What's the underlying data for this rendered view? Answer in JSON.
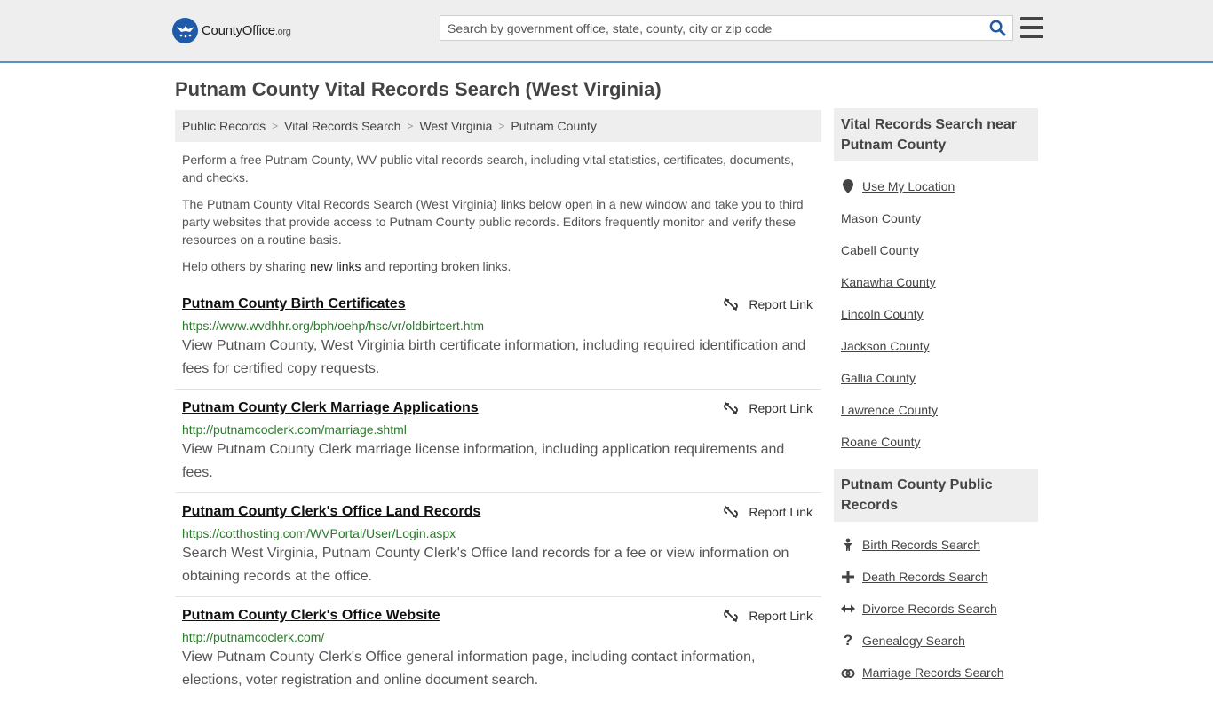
{
  "header": {
    "logo_text_main": "County",
    "logo_text_bold": "Office",
    "logo_text_org": ".org",
    "search_placeholder": "Search by government office, state, county, city or zip code"
  },
  "page_title": "Putnam County Vital Records Search (West Virginia)",
  "breadcrumb": [
    "Public Records",
    "Vital Records Search",
    "West Virginia",
    "Putnam County"
  ],
  "intro": {
    "p1": "Perform a free Putnam County, WV public vital records search, including vital statistics, certificates, documents, and checks.",
    "p2": "The Putnam County Vital Records Search (West Virginia) links below open in a new window and take you to third party websites that provide access to Putnam County public records. Editors frequently monitor and verify these resources on a routine basis.",
    "p3_before": "Help others by sharing ",
    "p3_link": "new links",
    "p3_after": " and reporting broken links."
  },
  "report_label": "Report Link",
  "listings": [
    {
      "title": "Putnam County Birth Certificates",
      "url": "https://www.wvdhhr.org/bph/oehp/hsc/vr/oldbirtcert.htm",
      "desc": "View Putnam County, West Virginia birth certificate information, including required identification and fees for certified copy requests."
    },
    {
      "title": "Putnam County Clerk Marriage Applications",
      "url": "http://putnamcoclerk.com/marriage.shtml",
      "desc": "View Putnam County Clerk marriage license information, including application requirements and fees."
    },
    {
      "title": "Putnam County Clerk's Office Land Records",
      "url": "https://cotthosting.com/WVPortal/User/Login.aspx",
      "desc": "Search West Virginia, Putnam County Clerk's Office land records for a fee or view information on obtaining records at the office."
    },
    {
      "title": "Putnam County Clerk's Office Website",
      "url": "http://putnamcoclerk.com/",
      "desc": "View Putnam County Clerk's Office general information page, including contact information, elections, voter registration and online document search."
    }
  ],
  "sidebar": {
    "near_title": "Vital Records Search near Putnam County",
    "use_location": "Use My Location",
    "near_items": [
      "Mason County",
      "Cabell County",
      "Kanawha County",
      "Lincoln County",
      "Jackson County",
      "Gallia County",
      "Lawrence County",
      "Roane County"
    ],
    "public_title": "Putnam County Public Records",
    "public_items": [
      {
        "label": "Birth Records Search",
        "icon": "baby-icon"
      },
      {
        "label": "Death Records Search",
        "icon": "cross-icon"
      },
      {
        "label": "Divorce Records Search",
        "icon": "arrows-horizontal-icon"
      },
      {
        "label": "Genealogy Search",
        "icon": "question-icon"
      },
      {
        "label": "Marriage Records Search",
        "icon": "rings-icon"
      }
    ]
  },
  "colors": {
    "accent_blue": "#1e5aa8",
    "url_green": "#2a7a2a",
    "header_bg": "#eeeeee"
  }
}
